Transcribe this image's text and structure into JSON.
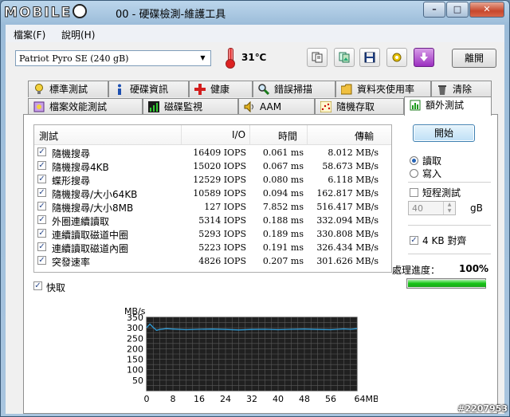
{
  "window": {
    "logo_text": "MOBILE",
    "title": "00 - 硬碟檢測-維護工具",
    "minimize": "–",
    "maximize": "□",
    "close": "✕"
  },
  "menu": [
    "檔案(F)",
    "說明(H)"
  ],
  "toolbar": {
    "drive": "Patriot Pyro SE (240 gB)",
    "temperature": "31℃",
    "exit_label": "離開"
  },
  "tabs_row1": [
    {
      "label": "標準測試",
      "icon": "lightbulb-icon"
    },
    {
      "label": "硬碟資訊",
      "icon": "info-icon"
    },
    {
      "label": "健康",
      "icon": "health-cross-icon"
    },
    {
      "label": "錯誤掃描",
      "icon": "magnifier-icon"
    },
    {
      "label": "資料夾使用率",
      "icon": "folder-icon"
    },
    {
      "label": "清除",
      "icon": "trash-icon"
    }
  ],
  "tabs_row2": [
    {
      "label": "檔案效能測試",
      "icon": "file-benchmark-icon"
    },
    {
      "label": "磁碟監視",
      "icon": "monitor-chart-icon"
    },
    {
      "label": "AAM",
      "icon": "speaker-icon"
    },
    {
      "label": "隨機存取",
      "icon": "scatter-icon"
    },
    {
      "label": "額外測試",
      "icon": "extra-test-icon"
    }
  ],
  "active_tab": "額外測試",
  "table": {
    "headers": [
      "測試",
      "I/O",
      "時間",
      "傳輸"
    ],
    "rows": [
      {
        "name": "隨機搜尋",
        "io": "16409 IOPS",
        "time": "0.061 ms",
        "transfer": "8.012 MB/s"
      },
      {
        "name": "隨機搜尋4KB",
        "io": "15020 IOPS",
        "time": "0.067 ms",
        "transfer": "58.673 MB/s"
      },
      {
        "name": "蝶形搜尋",
        "io": "12529 IOPS",
        "time": "0.080 ms",
        "transfer": "6.118 MB/s"
      },
      {
        "name": "隨機搜尋/大小64KB",
        "io": "10589 IOPS",
        "time": "0.094 ms",
        "transfer": "162.817 MB/s"
      },
      {
        "name": "隨機搜尋/大小8MB",
        "io": "127 IOPS",
        "time": "7.852 ms",
        "transfer": "516.417 MB/s"
      },
      {
        "name": "外圈連續讀取",
        "io": "5314 IOPS",
        "time": "0.188 ms",
        "transfer": "332.094 MB/s"
      },
      {
        "name": "連續讀取磁道中圈",
        "io": "5293 IOPS",
        "time": "0.189 ms",
        "transfer": "330.808 MB/s"
      },
      {
        "name": "連續讀取磁道內圈",
        "io": "5223 IOPS",
        "time": "0.191 ms",
        "transfer": "326.434 MB/s"
      },
      {
        "name": "突發速率",
        "io": "4826 IOPS",
        "time": "0.207 ms",
        "transfer": "301.626 MB/s"
      }
    ]
  },
  "cache_label": "快取",
  "controls": {
    "start": "開始",
    "read": "讀取",
    "write": "寫入",
    "short_test": "短程測試",
    "short_value": "40",
    "short_unit": "gB",
    "align_4kb": "4 KB 對齊",
    "progress_label": "處理進度：",
    "progress_text": "100%",
    "progress_value": 100
  },
  "chart_data": {
    "type": "line",
    "ylabel": "MB/s",
    "xlabel": "",
    "ylim": [
      0,
      350
    ],
    "xlim": [
      0,
      64
    ],
    "xticks": [
      "0",
      "8",
      "16",
      "24",
      "32",
      "40",
      "48",
      "56",
      "64MB"
    ],
    "yticks": [
      "50",
      "100",
      "150",
      "200",
      "250",
      "300",
      "350"
    ],
    "grid": true,
    "series": [
      {
        "x": [
          0,
          1,
          2,
          3,
          4,
          6,
          8,
          12,
          16,
          20,
          24,
          28,
          32,
          36,
          40,
          44,
          48,
          52,
          56,
          60,
          62,
          64
        ],
        "values": [
          300,
          318,
          302,
          288,
          292,
          296,
          294,
          291,
          293,
          294,
          292,
          290,
          292,
          293,
          291,
          293,
          294,
          292,
          291,
          295,
          293,
          296
        ]
      }
    ]
  },
  "watermark": "#2207953",
  "colors": {
    "chart_bg": "#202020",
    "grid": "#5a5a5a",
    "line": "#2e9bd6",
    "progress": "#16c416"
  }
}
